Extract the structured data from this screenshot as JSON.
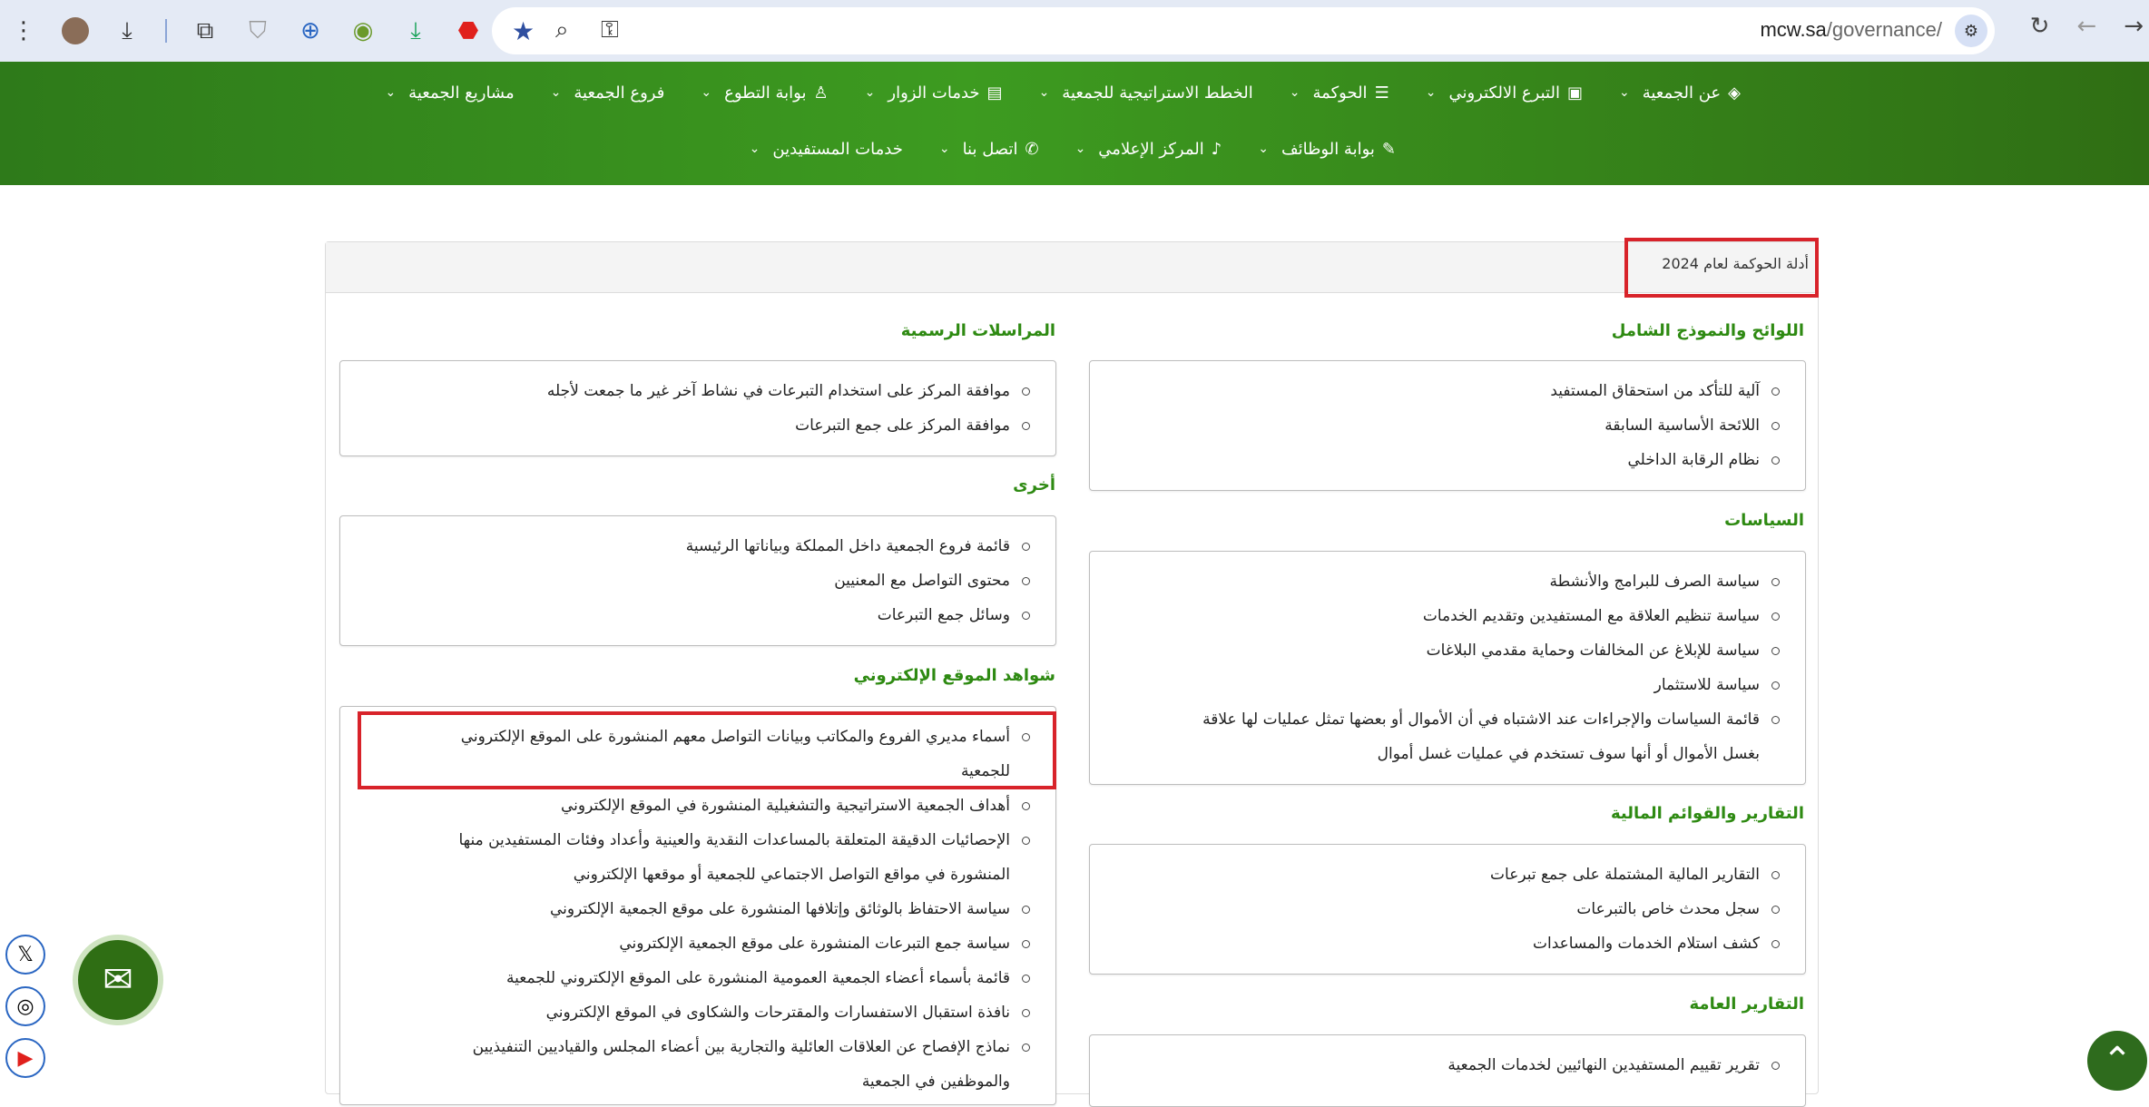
{
  "browser": {
    "url_host": "mcw.sa",
    "url_path": "/governance/",
    "icons": [
      "menu-dots-icon",
      "avatar",
      "download-icon",
      "extensions-icon",
      "shield-icon",
      "translate-icon",
      "ext-icon",
      "download-arrow-icon",
      "adblock-icon"
    ]
  },
  "menu": {
    "row1": [
      {
        "label": "عن الجمعية",
        "icon": "◈"
      },
      {
        "label": "التبرع الالكتروني",
        "icon": "▣"
      },
      {
        "label": "الحوكمة",
        "icon": "☰"
      },
      {
        "label": "الخطط الاستراتيجية للجمعية",
        "icon": ""
      },
      {
        "label": "خدمات الزوار",
        "icon": "▤"
      },
      {
        "label": "بوابة التطوع",
        "icon": "♙"
      },
      {
        "label": "فروع الجمعية",
        "icon": ""
      },
      {
        "label": "مشاريع الجمعية",
        "icon": ""
      }
    ],
    "row2": [
      {
        "label": "بوابة الوظائف",
        "icon": "✎"
      },
      {
        "label": "المركز الإعلامي",
        "icon": "♪"
      },
      {
        "label": "اتصل بنا",
        "icon": "✆"
      },
      {
        "label": "خدمات المستفيدين",
        "icon": ""
      }
    ]
  },
  "card": {
    "header": "أدلة الحوكمة لعام 2024"
  },
  "sections": {
    "regulations": {
      "title": "اللوائح والنموذج الشامل",
      "items": [
        "آلية للتأكد من استحقاق المستفيد",
        "اللائحة الأساسية السابقة",
        "نظام الرقابة الداخلي"
      ]
    },
    "policies": {
      "title": "السياسات",
      "items": [
        "سياسة الصرف للبرامج والأنشطة",
        "سياسة تنظيم العلاقة مع المستفيدين وتقديم الخدمات",
        "سياسة للإبلاغ عن المخالفات وحماية مقدمي البلاغات",
        "سياسة للاستثمار",
        "قائمة السياسات والإجراءات عند الاشتباه في أن الأموال أو بعضها تمثل عمليات لها علاقة",
        "بغسل الأموال أو أنها سوف تستخدم في عمليات غسل أموال"
      ]
    },
    "financial": {
      "title": "التقارير والقوائم المالية",
      "items": [
        "التقارير المالية المشتملة على جمع تبرعات",
        "سجل محدث خاص بالتبرعات",
        "كشف استلام الخدمات والمساعدات"
      ]
    },
    "general_reports": {
      "title": "التقارير العامة",
      "items": [
        "تقرير تقييم المستفيدين النهائيين لخدمات الجمعية"
      ]
    },
    "correspondence": {
      "title": "المراسلات الرسمية",
      "items": [
        "موافقة المركز على استخدام التبرعات في نشاط آخر غير ما جمعت لأجله",
        "موافقة المركز على جمع التبرعات"
      ]
    },
    "other": {
      "title": "أخرى",
      "items": [
        "قائمة فروع الجمعية داخل المملكة وبياناتها الرئيسية",
        "محتوى التواصل مع المعنيين",
        "وسائل جمع التبرعات"
      ]
    },
    "website": {
      "title": "شواهد الموقع الإلكتروني",
      "items": [
        "أسماء مديري الفروع والمكاتب وبيانات التواصل معهم المنشورة على الموقع الإلكتروني",
        "للجمعية",
        "أهداف الجمعية الاستراتيجية والتشغيلية المنشورة في الموقع الإلكتروني",
        "الإحصائيات الدقيقة المتعلقة بالمساعدات النقدية والعينية وأعداد وفئات المستفيدين منها",
        "المنشورة في مواقع التواصل الاجتماعي للجمعية أو موقعها الإلكتروني",
        "سياسة الاحتفاظ بالوثائق وإتلافها المنشورة على موقع الجمعية الإلكتروني",
        "سياسة جمع التبرعات المنشورة على موقع الجمعية الإلكتروني",
        "قائمة بأسماء أعضاء الجمعية العمومية المنشورة على الموقع الإلكتروني للجمعية",
        "نافذة استقبال الاستفسارات والمقترحات والشكاوى في الموقع الإلكتروني",
        "نماذج الإفصاح عن العلاقات العائلية والتجارية بين أعضاء المجلس والقياديين التنفيذيين",
        "والموظفين في الجمعية"
      ]
    }
  },
  "widgets": {
    "social": [
      "x-icon",
      "instagram-icon",
      "youtube-icon"
    ],
    "mail": "mail-icon",
    "scroll_up": "chevron-up-icon"
  }
}
